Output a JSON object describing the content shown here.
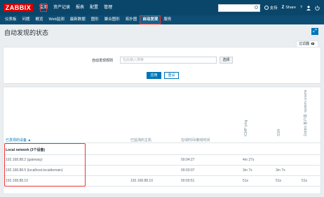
{
  "app": {
    "logo": "ZABBIX"
  },
  "menu": [
    "监测",
    "资产记录",
    "报表",
    "配置",
    "管理"
  ],
  "topright": {
    "support": "支持",
    "share": "Share",
    "help": "?"
  },
  "submenu": [
    "仪表板",
    "问题",
    "概览",
    "Web监测",
    "最新数据",
    "图形",
    "聚合图形",
    "拓扑图",
    "自动发现",
    "服务"
  ],
  "page": {
    "title": "自动发现的状态"
  },
  "filter": {
    "tab_label": "过滤器",
    "rule_label": "自动发现规则",
    "placeholder": "在此输入搜索",
    "select_label": "选择",
    "apply": "应用",
    "reset": "重设"
  },
  "table": {
    "headers": {
      "device": "已发现的设备",
      "monitored_host": "已监测的主机",
      "uptime": "在线时间/离线时间",
      "icmp": "ICMP ping",
      "ssh": "SSH",
      "zabbix": "Zabbix 客户端: system.uname"
    },
    "group_row": "Local network (3个设备)",
    "rows": [
      {
        "device": "192.168.88.2 (gateway)",
        "host": "",
        "uptime": "00:04:27",
        "icmp": "4m 27s",
        "ssh": "",
        "zabbix": ""
      },
      {
        "device": "192.168.88.5 (localhost.localdomain)",
        "host": "",
        "uptime": "00:03:07",
        "icmp": "3m 7s",
        "ssh": "3m 7s",
        "zabbix": ""
      },
      {
        "device": "192.168.88.10",
        "host": "192.168.88.10",
        "uptime": "00:00:51",
        "icmp": "51s",
        "ssh": "51s",
        "zabbix": "51s"
      }
    ]
  }
}
